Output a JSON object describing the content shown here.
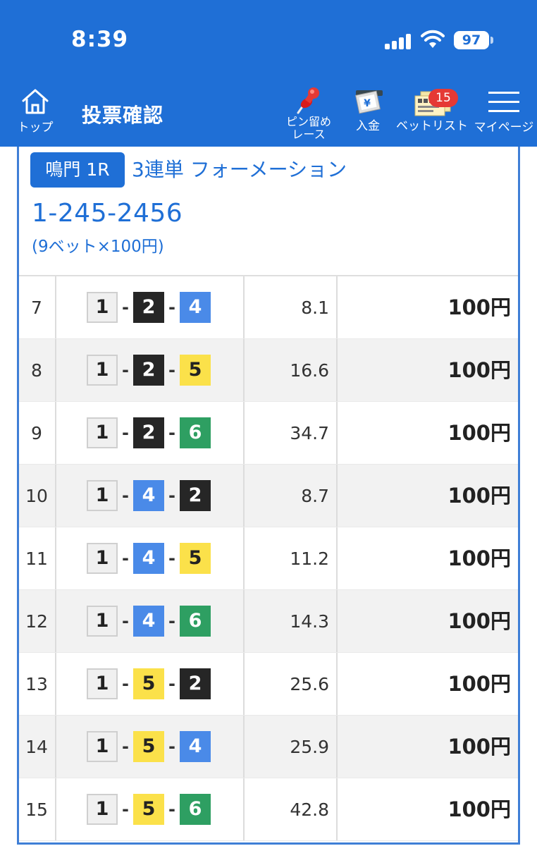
{
  "status_bar": {
    "time": "8:39",
    "battery": "97"
  },
  "header": {
    "home_label": "トップ",
    "title": "投票確認",
    "pin_label_line1": "ピン留め",
    "pin_label_line2": "レース",
    "deposit_label": "入金",
    "deposit_icon_glyph": "¥",
    "betlist_label": "ベットリスト",
    "betlist_badge": "15",
    "mypage_label": "マイページ"
  },
  "bet": {
    "race": "鳴門 1R",
    "type": "3連単 フォーメーション",
    "combination": "1-245-2456",
    "summary": "(9ベット×100円)"
  },
  "colors": {
    "brand_blue": "#1f6fd6",
    "boat_1": "#f0f0f0",
    "boat_2": "#262626",
    "boat_4": "#4a8ae8",
    "boat_5": "#fbe14a",
    "boat_6": "#2e9f62"
  },
  "rows": [
    {
      "no": "7",
      "b1": "1",
      "b2": "2",
      "b3": "4",
      "odds": "8.1",
      "amount": "100円"
    },
    {
      "no": "8",
      "b1": "1",
      "b2": "2",
      "b3": "5",
      "odds": "16.6",
      "amount": "100円"
    },
    {
      "no": "9",
      "b1": "1",
      "b2": "2",
      "b3": "6",
      "odds": "34.7",
      "amount": "100円"
    },
    {
      "no": "10",
      "b1": "1",
      "b2": "4",
      "b3": "2",
      "odds": "8.7",
      "amount": "100円"
    },
    {
      "no": "11",
      "b1": "1",
      "b2": "4",
      "b3": "5",
      "odds": "11.2",
      "amount": "100円"
    },
    {
      "no": "12",
      "b1": "1",
      "b2": "4",
      "b3": "6",
      "odds": "14.3",
      "amount": "100円"
    },
    {
      "no": "13",
      "b1": "1",
      "b2": "5",
      "b3": "2",
      "odds": "25.6",
      "amount": "100円"
    },
    {
      "no": "14",
      "b1": "1",
      "b2": "5",
      "b3": "4",
      "odds": "25.9",
      "amount": "100円"
    },
    {
      "no": "15",
      "b1": "1",
      "b2": "5",
      "b3": "6",
      "odds": "42.8",
      "amount": "100円"
    }
  ]
}
